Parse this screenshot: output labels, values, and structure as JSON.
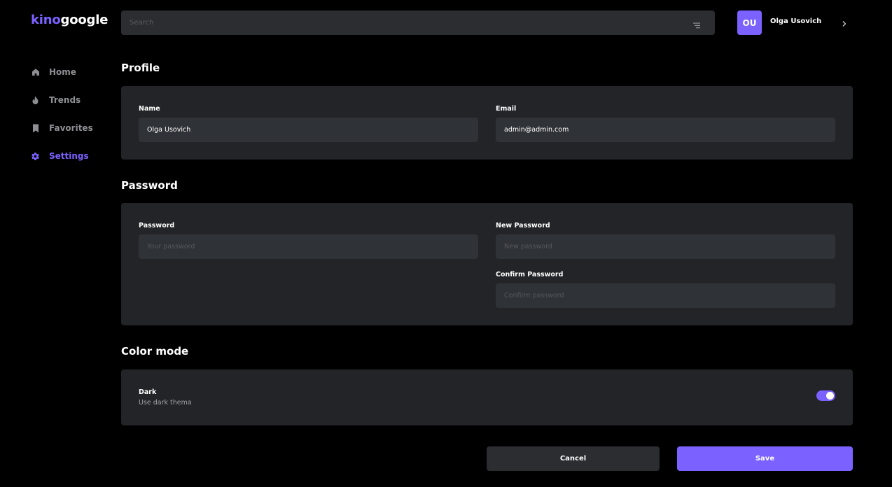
{
  "brand": {
    "part1": "kino",
    "part2": "google"
  },
  "nav": [
    {
      "label": "Home",
      "icon": "home-icon"
    },
    {
      "label": "Trends",
      "icon": "fire-icon"
    },
    {
      "label": "Favorites",
      "icon": "bookmark-icon"
    },
    {
      "label": "Settings",
      "icon": "gear-icon",
      "active": true
    }
  ],
  "search": {
    "placeholder": "Search",
    "value": ""
  },
  "user": {
    "initials": "OU",
    "name": "Olga Usovich"
  },
  "profile": {
    "title": "Profile",
    "name_label": "Name",
    "name_value": "Olga Usovich",
    "email_label": "Email",
    "email_value": "admin@admin.com"
  },
  "password": {
    "title": "Password",
    "password_label": "Password",
    "password_placeholder": "Your password",
    "new_label": "New Password",
    "new_placeholder": "New password",
    "confirm_label": "Confirm Password",
    "confirm_placeholder": "Confirm password"
  },
  "color_mode": {
    "title": "Color mode",
    "option_title": "Dark",
    "option_desc": "Use dark thema",
    "enabled": true
  },
  "actions": {
    "cancel": "Cancel",
    "save": "Save"
  },
  "colors": {
    "accent": "#7b61ff",
    "background": "#000000",
    "panel": "#232427",
    "input": "#2f3236"
  }
}
